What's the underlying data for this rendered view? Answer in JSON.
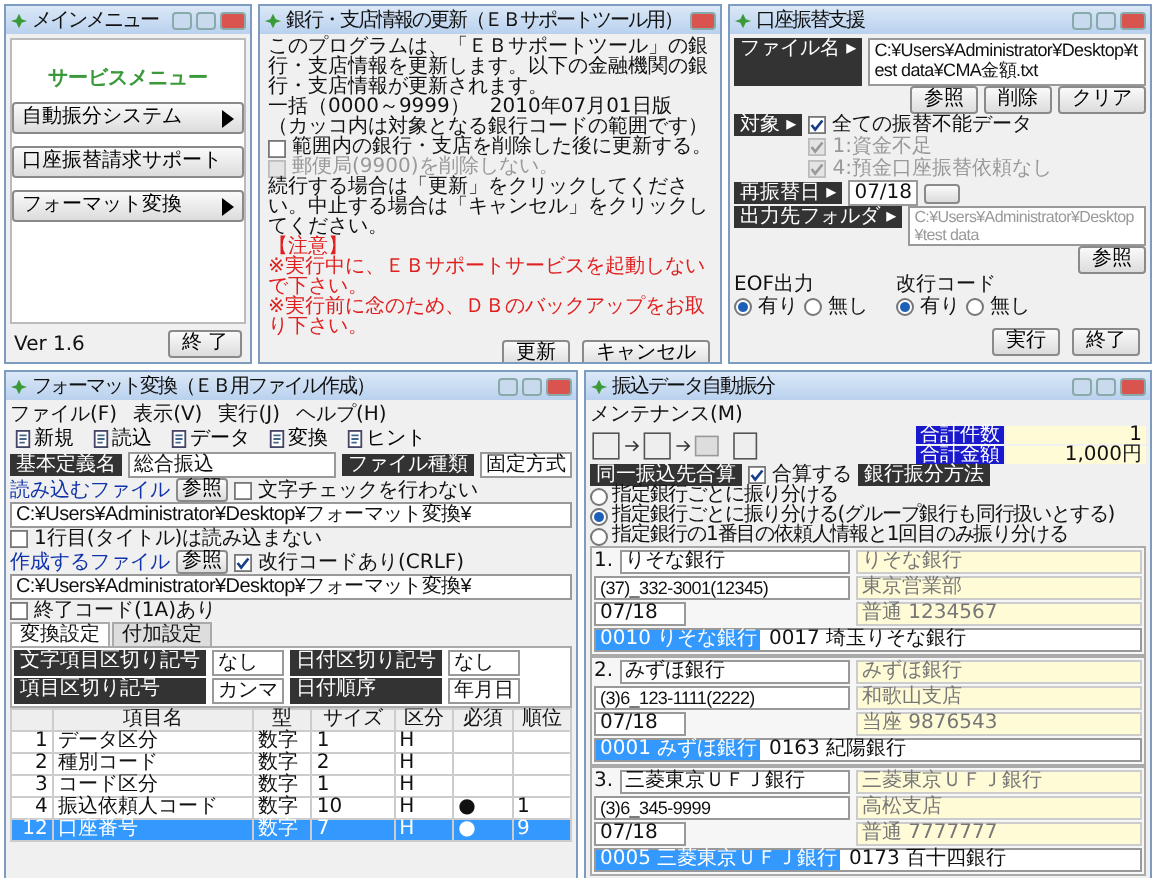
{
  "main_menu": {
    "title": "メインメニュー",
    "heading": "サービスメニュー",
    "buttons": [
      {
        "label": "自動振分システム",
        "arrow": true
      },
      {
        "label": "口座振替請求サポート",
        "arrow": false
      },
      {
        "label": "フォーマット変換",
        "arrow": true
      }
    ],
    "version": "Ver 1.6",
    "exit_button": "終 了"
  },
  "update_dialog": {
    "title": "銀行・支店情報の更新（ＥＢサポートツール用）",
    "message": [
      "このプログラムは、「ＥＢサポートツール」の銀行・支店情報を更新します。以下の金融機関の銀行・支店情報が更新されます。",
      "一括（0000～9999）　2010年07月01日版",
      "（カッコ内は対象となる銀行コードの範囲です）"
    ],
    "checkboxes": [
      {
        "label": "範囲内の銀行・支店を削除した後に更新する。",
        "checked": false,
        "disabled": false
      },
      {
        "label": "郵便局(9900)を削除しない。",
        "checked": false,
        "disabled": true
      }
    ],
    "instruction": "続行する場合は「更新」をクリックしてください。中止する場合は「キャンセル」をクリックしてください。",
    "notice_title": "【注意】",
    "notices": [
      "※実行中に、ＥＢサポートサービスを起動しないで下さい。",
      "※実行前に念のため、ＤＢのバックアップをお取り下さい。"
    ],
    "buttons": [
      "更新",
      "キャンセル"
    ]
  },
  "account_window": {
    "title": "口座振替支援",
    "file_label": "ファイル名 ▸",
    "file_path": "C:¥Users¥Administrator¥Desktop¥test data¥CMA金額.txt",
    "file_buttons": [
      "参照",
      "削除",
      "クリア"
    ],
    "target_label": "対象 ▸",
    "targets": [
      {
        "label": "全ての振替不能データ",
        "checked": true,
        "disabled": false
      },
      {
        "label": "1:資金不足",
        "checked": true,
        "disabled": true
      },
      {
        "label": "4:預金口座振替依頼なし",
        "checked": true,
        "disabled": true
      }
    ],
    "date_label": "再振替日 ▸",
    "date_value": "07/18",
    "output_label": "出力先フォルダ ▸",
    "output_path": "C:¥Users¥Administrator¥Desktop¥test data",
    "browse_button": "参照",
    "groups": [
      {
        "label": "EOF出力",
        "options": [
          {
            "label": "有り",
            "selected": true
          },
          {
            "label": "無し",
            "selected": false
          }
        ]
      },
      {
        "label": "改行コード",
        "options": [
          {
            "label": "有り",
            "selected": true
          },
          {
            "label": "無し",
            "selected": false
          }
        ]
      }
    ],
    "buttons": [
      "実行",
      "終了"
    ]
  },
  "format_window": {
    "title": "フォーマット変換（ＥＢ用ファイル作成）",
    "menu": [
      "ファイル(F)",
      "表示(V)",
      "実行(J)",
      "ヘルプ(H)"
    ],
    "toolbar": [
      "新規",
      "読込",
      "データ",
      "変換",
      "ヒント"
    ],
    "template_label": "基本定義名",
    "template_value": "総合振込",
    "read_label": "読み込むファイル",
    "read_path": "C:¥Users¥Administrator¥Desktop¥フォーマット変換¥",
    "browse_button": "参照",
    "filetype_label": "ファイル種類",
    "filetype_value": "固定方式",
    "read_checks": [
      {
        "label": "文字チェックを行わない",
        "checked": false
      },
      {
        "label": "1行目(タイトル)は読み込まない",
        "checked": false
      }
    ],
    "create_label": "作成するファイル",
    "create_path": "C:¥Users¥Administrator¥Desktop¥フォーマット変換¥",
    "create_button": "参照",
    "create_checks": [
      {
        "label": "改行コードあり(CRLF)",
        "checked": true
      },
      {
        "label": "終了コード(1A)あり",
        "checked": false
      }
    ],
    "tabs": [
      {
        "label": "変換設定",
        "selected": true
      },
      {
        "label": "付加設定",
        "selected": false
      }
    ],
    "settings": [
      {
        "label": "文字項目区切り記号",
        "value": "なし"
      },
      {
        "label": "日付区切り記号",
        "value": "なし"
      },
      {
        "label": "項目区切り記号",
        "value": "カンマ"
      },
      {
        "label": "日付順序",
        "value": "年月日"
      }
    ],
    "columns": [
      "項目名",
      "型",
      "サイズ",
      "区分",
      "必須",
      "順位"
    ],
    "rows": [
      {
        "no": "1",
        "cells": [
          "データ区分",
          "数字",
          "1",
          "H",
          "",
          ""
        ],
        "selected": false
      },
      {
        "no": "2",
        "cells": [
          "種別コード",
          "数字",
          "2",
          "H",
          "",
          ""
        ],
        "selected": false
      },
      {
        "no": "3",
        "cells": [
          "コード区分",
          "数字",
          "1",
          "H",
          "",
          ""
        ],
        "selected": false
      },
      {
        "no": "4",
        "cells": [
          "振込依頼人コード",
          "数字",
          "10",
          "H",
          "●",
          "1"
        ],
        "selected": false
      },
      {
        "no": "12",
        "cells": [
          "口座番号",
          "数字",
          "7",
          "H",
          "●",
          "9"
        ],
        "selected": true
      }
    ]
  },
  "transfer_window": {
    "title": "振込データ自動振分",
    "menu": [
      "メンテナンス(M)"
    ],
    "totals": [
      {
        "label": "合計件数",
        "value": "1"
      },
      {
        "label": "合計金額",
        "value": "1,000円"
      }
    ],
    "merge_label": "同一振込先合算",
    "merge_check": {
      "label": "合算する",
      "checked": true
    },
    "method_label": "銀行振分方法",
    "methods": [
      {
        "label": "指定銀行ごとに振り分ける",
        "selected": false
      },
      {
        "label": "指定銀行ごとに振り分ける(グループ銀行も同行扱いとする)",
        "selected": true
      },
      {
        "label": "指定銀行の1番目の依頼人情報と1回目のみ振り分ける",
        "selected": false
      }
    ],
    "sections": [
      {
        "number": "1.",
        "bank": "りそな銀行",
        "consignor": "(37)_332-3001(12345)",
        "bank_name": "りそな銀行",
        "branch_name": "東京営業部",
        "account": "普通 1234567",
        "date": "07/18",
        "branches": [
          {
            "code": "0010",
            "name": "りそな銀行",
            "selected": true
          },
          {
            "code": "0017",
            "name": "埼玉りそな銀行",
            "selected": false
          }
        ]
      },
      {
        "number": "2.",
        "bank": "みずほ銀行",
        "consignor": "(3)6_123-1111(2222)",
        "bank_name": "みずほ銀行",
        "branch_name": "和歌山支店",
        "account": "当座 9876543",
        "date": "07/18",
        "branches": [
          {
            "code": "0001",
            "name": "みずほ銀行",
            "selected": true
          },
          {
            "code": "0163",
            "name": "紀陽銀行",
            "selected": false
          }
        ]
      },
      {
        "number": "3.",
        "bank": "三菱東京ＵＦＪ銀行",
        "consignor": "(3)6_345-9999",
        "bank_name": "三菱東京ＵＦＪ銀行",
        "branch_name": "高松支店",
        "account": "普通 7777777",
        "date": "07/18",
        "branches": [
          {
            "code": "0005",
            "name": "三菱東京ＵＦＪ銀行",
            "selected": true
          },
          {
            "code": "0173",
            "name": "百十四銀行",
            "selected": false
          }
        ]
      }
    ]
  }
}
